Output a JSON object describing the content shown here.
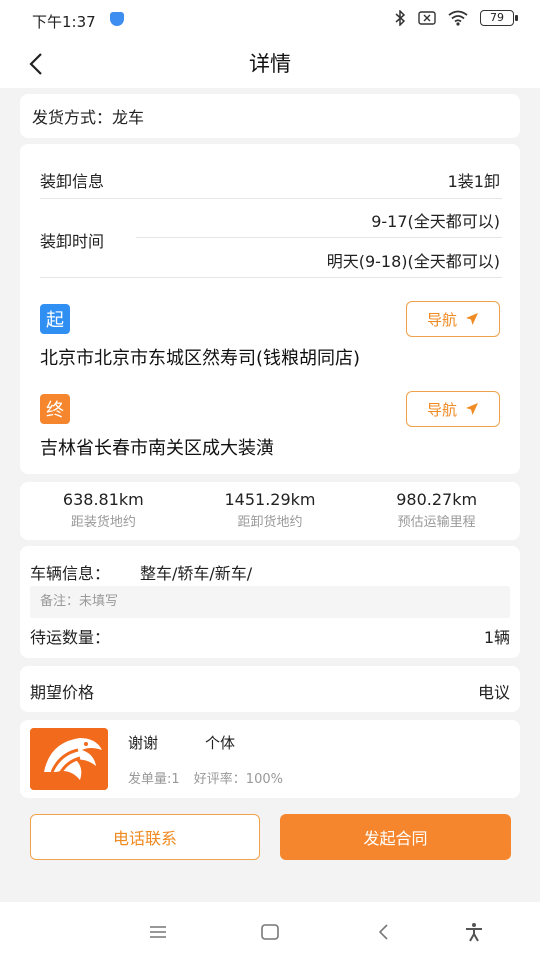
{
  "status": {
    "time": "下午1:37",
    "battery": "79"
  },
  "header": {
    "title": "详情"
  },
  "shipping": {
    "label": "发货方式：",
    "value": "龙车"
  },
  "loading": {
    "info_label": "装卸信息",
    "info_value": "1装1卸",
    "time_label": "装卸时间",
    "time_load": "9-17(全天都可以)",
    "time_unload": "明天(9-18)(全天都可以)"
  },
  "start": {
    "badge": "起",
    "nav_label": "导航",
    "address": "北京市北京市东城区然寿司(钱粮胡同店)"
  },
  "end": {
    "badge": "终",
    "nav_label": "导航",
    "address": "吉林省长春市南关区成大装潢"
  },
  "distances": [
    {
      "value": "638.81km",
      "label": "距装货地约"
    },
    {
      "value": "1451.29km",
      "label": "距卸货地约"
    },
    {
      "value": "980.27km",
      "label": "预估运输里程"
    }
  ],
  "vehicle": {
    "label": "车辆信息：",
    "value": "整车/轿车/新车/",
    "remark": "备注：未填写",
    "qty_label": "待运数量：",
    "qty_value": "1辆"
  },
  "price": {
    "label": "期望价格",
    "value": "电议"
  },
  "user": {
    "name": "谢谢",
    "type": "个体",
    "orders": "发单量:1",
    "rating": "好评率：100%"
  },
  "actions": {
    "call": "电话联系",
    "contract": "发起合同"
  },
  "colors": {
    "accent": "#f5862d",
    "start_badge": "#2f8ff3",
    "end_badge": "#f5862d"
  }
}
